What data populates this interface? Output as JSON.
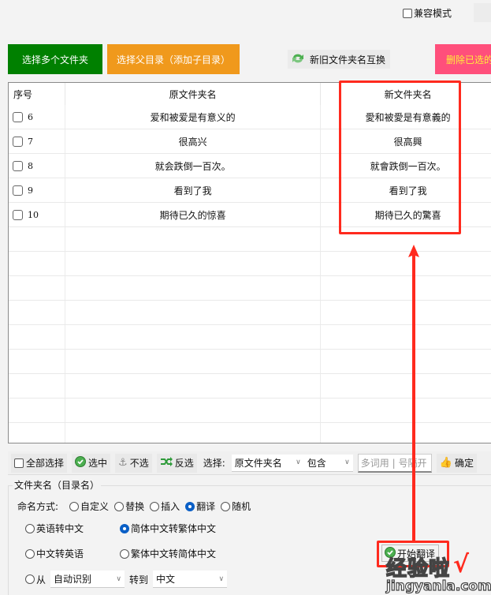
{
  "top": {
    "compat_mode_label": "兼容模式",
    "compat_mode_checked": false
  },
  "buttons": {
    "select_multiple_folders": "选择多个文件夹",
    "select_parent_dir": "选择父目录（添加子目录）",
    "swap_names": "新旧文件夹名互换",
    "delete_selected": "删除已选的"
  },
  "table": {
    "headers": {
      "index": "序号",
      "original": "原文件夹名",
      "new": "新文件夹名"
    },
    "rows": [
      {
        "index": "6",
        "original": "爱和被爱是有意义的",
        "new": "愛和被愛是有意義的",
        "checked": false
      },
      {
        "index": "7",
        "original": "很高兴",
        "new": "很高興",
        "checked": false
      },
      {
        "index": "8",
        "original": "就会跌倒一百次。",
        "new": "就會跌倒一百次。",
        "checked": false
      },
      {
        "index": "9",
        "original": "看到了我",
        "new": "看到了我",
        "checked": false
      },
      {
        "index": "10",
        "original": "期待已久的惊喜",
        "new": "期待已久的驚喜",
        "checked": false
      }
    ]
  },
  "toolbar": {
    "select_all": "全部选择",
    "check": "选中",
    "uncheck": "不选",
    "invert": "反选",
    "select_label": "选择:",
    "field_select": "原文件夹名",
    "match_select": "包含",
    "keyword_placeholder": "多词用 | 号隔开",
    "confirm": "确定"
  },
  "group": {
    "title": "文件夹名（目录名）",
    "naming_label": "命名方式:",
    "naming_options": [
      {
        "label": "自定义",
        "selected": false
      },
      {
        "label": "替换",
        "selected": false
      },
      {
        "label": "插入",
        "selected": false
      },
      {
        "label": "翻译",
        "selected": true
      },
      {
        "label": "随机",
        "selected": false
      }
    ],
    "translate_options": [
      {
        "label": "英语转中文",
        "selected": false
      },
      {
        "label": "简体中文转繁体中文",
        "selected": true
      },
      {
        "label": "中文转英语",
        "selected": false
      },
      {
        "label": "繁体中文转简体中文",
        "selected": false
      }
    ],
    "from_label": "从",
    "from_select": "自动识别",
    "to_label": "转到",
    "to_select": "中文",
    "start_button": "开始翻译"
  },
  "watermark": {
    "cn": "经验啦",
    "en": "jingyanla.com",
    "check": "√"
  },
  "colors": {
    "green_button": "#008000",
    "orange_button": "#f0991c",
    "pink_button": "#ff4f7b",
    "annotation_red": "#ff2a1e",
    "radio_selected": "#0a5fc6"
  }
}
